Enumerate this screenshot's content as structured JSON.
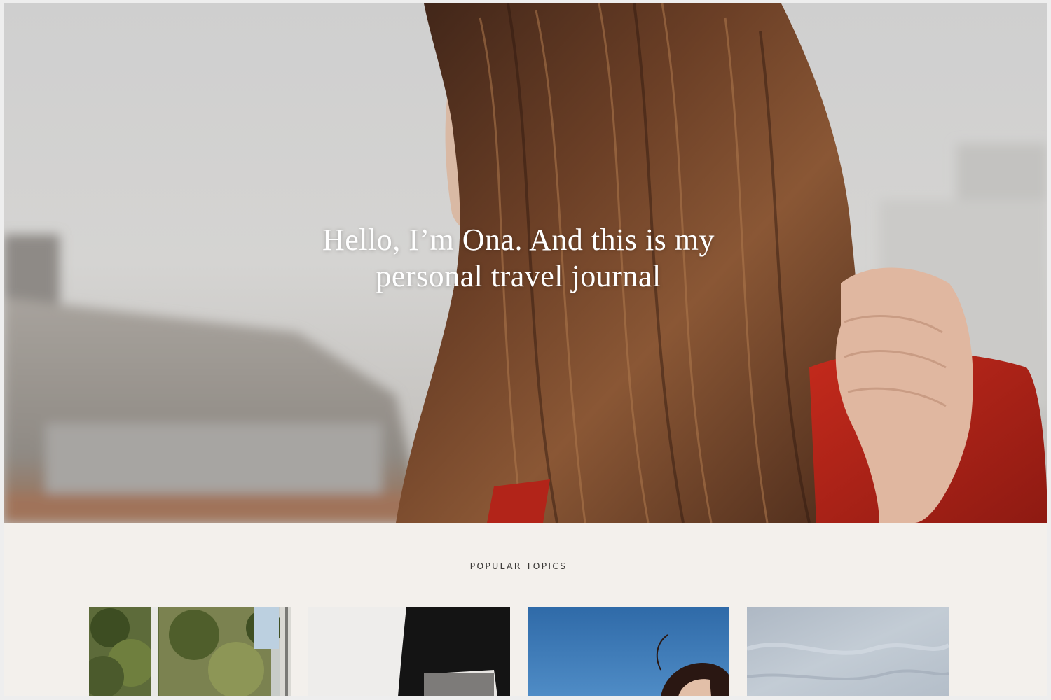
{
  "hero": {
    "title_line1": "Hello, I’m Ona. And this is my",
    "title_line2": "personal travel journal",
    "image": "woman-with-long-brown-hair-red-jacket"
  },
  "topics": {
    "heading": "POPULAR TOPICS",
    "cards": [
      {
        "image": "trees-through-window"
      },
      {
        "image": "person-black-sweater-grey-skirt"
      },
      {
        "image": "blue-sky-person-hair"
      },
      {
        "image": "grey-blue-texture"
      }
    ]
  },
  "colors": {
    "page_bg": "#f3f0ec",
    "heading_text": "#3a3836",
    "hero_text": "#ffffff",
    "accent_red": "#b42418"
  }
}
